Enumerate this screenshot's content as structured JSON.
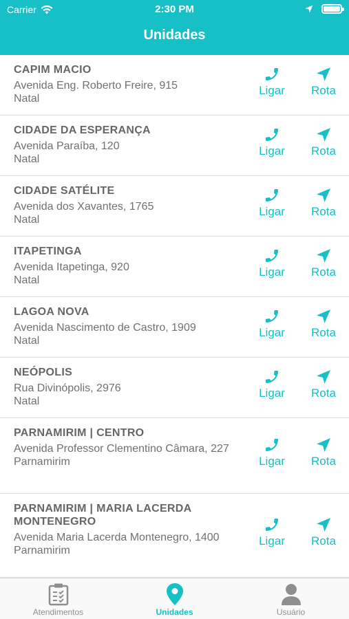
{
  "status_bar": {
    "carrier": "Carrier",
    "time": "2:30 PM"
  },
  "header": {
    "title": "Unidades"
  },
  "accent_color": "#16c0c6",
  "actions": {
    "call_label": "Ligar",
    "route_label": "Rota"
  },
  "units": [
    {
      "name": "CAPIM MACIO",
      "address": "Avenida Eng. Roberto Freire, 915",
      "city": "Natal"
    },
    {
      "name": "CIDADE DA ESPERANÇA",
      "address": "Avenida Paraíba, 120",
      "city": "Natal"
    },
    {
      "name": "CIDADE SATÉLITE",
      "address": "Avenida dos Xavantes, 1765",
      "city": "Natal"
    },
    {
      "name": "ITAPETINGA",
      "address": "Avenida Itapetinga, 920",
      "city": "Natal"
    },
    {
      "name": "LAGOA NOVA",
      "address": "Avenida Nascimento de Castro, 1909",
      "city": "Natal"
    },
    {
      "name": "NEÓPOLIS",
      "address": "Rua Divinópolis, 2976",
      "city": "Natal"
    },
    {
      "name": "PARNAMIRIM | CENTRO",
      "address": "Avenida Professor Clementino Câmara, 227",
      "city": "Parnamirim"
    },
    {
      "name": "PARNAMIRIM | MARIA LACERDA MONTENEGRO",
      "address": "Avenida Maria Lacerda Montenegro, 1400",
      "city": "Parnamirim"
    }
  ],
  "tabbar": {
    "tabs": [
      {
        "label": "Atendimentos",
        "icon": "clipboard-icon"
      },
      {
        "label": "Unidades",
        "icon": "location-pin-icon"
      },
      {
        "label": "Usuário",
        "icon": "user-icon"
      }
    ],
    "active": "Unidades"
  }
}
